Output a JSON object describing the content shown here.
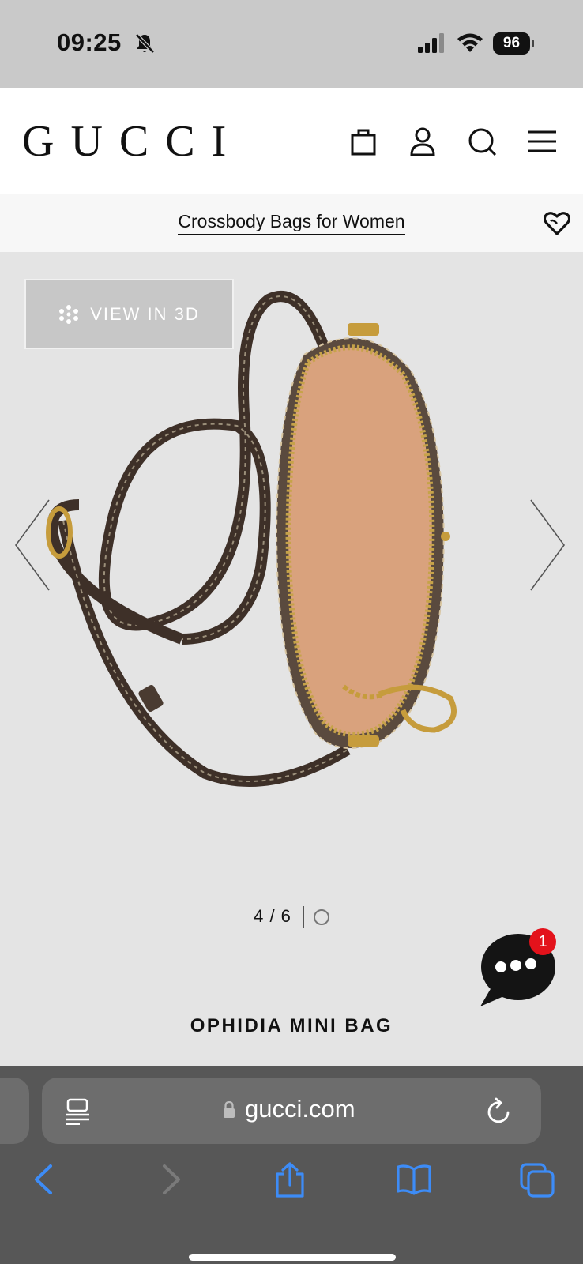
{
  "status_bar": {
    "time": "09:25",
    "battery": "96",
    "icons": [
      "bell-slash-icon",
      "signal-icon",
      "wifi-icon",
      "battery-icon"
    ]
  },
  "header": {
    "logo": "GUCCI",
    "icons": [
      "shopping-bag-icon",
      "account-icon",
      "search-icon",
      "menu-icon"
    ]
  },
  "breadcrumb": {
    "label": "Crossbody Bags for Women",
    "wishlist_icon": "heart-icon"
  },
  "gallery": {
    "view_3d_label": "VIEW IN 3D",
    "pager": "4 / 6",
    "image": "product-photo-ophidia-mini-bag",
    "chat_badge": "1"
  },
  "product": {
    "name": "OPHIDIA MINI BAG"
  },
  "browser": {
    "url": "gucci.com",
    "toolbar_icons": [
      "back-icon",
      "forward-icon",
      "share-icon",
      "bookmarks-icon",
      "tabs-icon"
    ]
  },
  "colors": {
    "accent_blue": "#3d8cf7",
    "badge_red": "#e3121b",
    "brand_black": "#111111"
  }
}
